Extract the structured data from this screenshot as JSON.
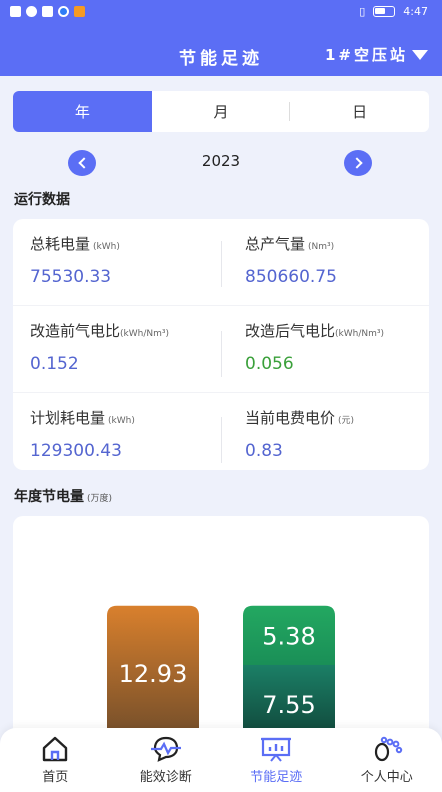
{
  "status_bar": {
    "time": "4:47"
  },
  "header": {
    "title": "节能足迹",
    "station": "1#空压站"
  },
  "tabs": [
    {
      "label": "年",
      "active": true
    },
    {
      "label": "月",
      "active": false
    },
    {
      "label": "日",
      "active": false
    }
  ],
  "year_nav": {
    "year": "2023"
  },
  "operation": {
    "title": "运行数据",
    "metrics": [
      {
        "label": "总耗电量",
        "unit": "(kWh)",
        "value": "75530.33"
      },
      {
        "label": "总产气量",
        "unit": "(Nm³)",
        "value": "850660.75"
      },
      {
        "label": "改造前气电比",
        "unit": "(kWh/Nm³)",
        "value": "0.152"
      },
      {
        "label": "改造后气电比",
        "unit": "(kWh/Nm³)",
        "value": "0.056"
      },
      {
        "label": "计划耗电量",
        "unit": "(kWh)",
        "value": "129300.43"
      },
      {
        "label": "当前电费电价",
        "unit": "(元)",
        "value": "0.83"
      }
    ]
  },
  "savings": {
    "title": "年度节电量",
    "unit": "(万度)"
  },
  "chart_data": {
    "type": "bar",
    "categories": [
      "",
      ""
    ],
    "series": [
      {
        "values": [
          12.93,
          7.55
        ],
        "colors": [
          "#d2792b",
          "#1e7a63"
        ]
      },
      {
        "values": [
          0,
          5.38
        ],
        "colors": [
          "#d2792b",
          "#1f9f5c"
        ]
      }
    ],
    "labels": [
      "12.93",
      "7.55",
      "5.38"
    ],
    "title": "年度节电量",
    "xlabel": "",
    "ylabel": ""
  },
  "bottom_nav": [
    {
      "label": "首页",
      "icon": "home-icon",
      "active": false
    },
    {
      "label": "能效诊断",
      "icon": "diagnosis-icon",
      "active": false
    },
    {
      "label": "节能足迹",
      "icon": "footprint-chart-icon",
      "active": true
    },
    {
      "label": "个人中心",
      "icon": "footprints-icon",
      "active": false
    }
  ],
  "colors": {
    "accent": "#5b6ef5",
    "value_blue": "#5465d0",
    "value_green": "#3aa03a"
  }
}
